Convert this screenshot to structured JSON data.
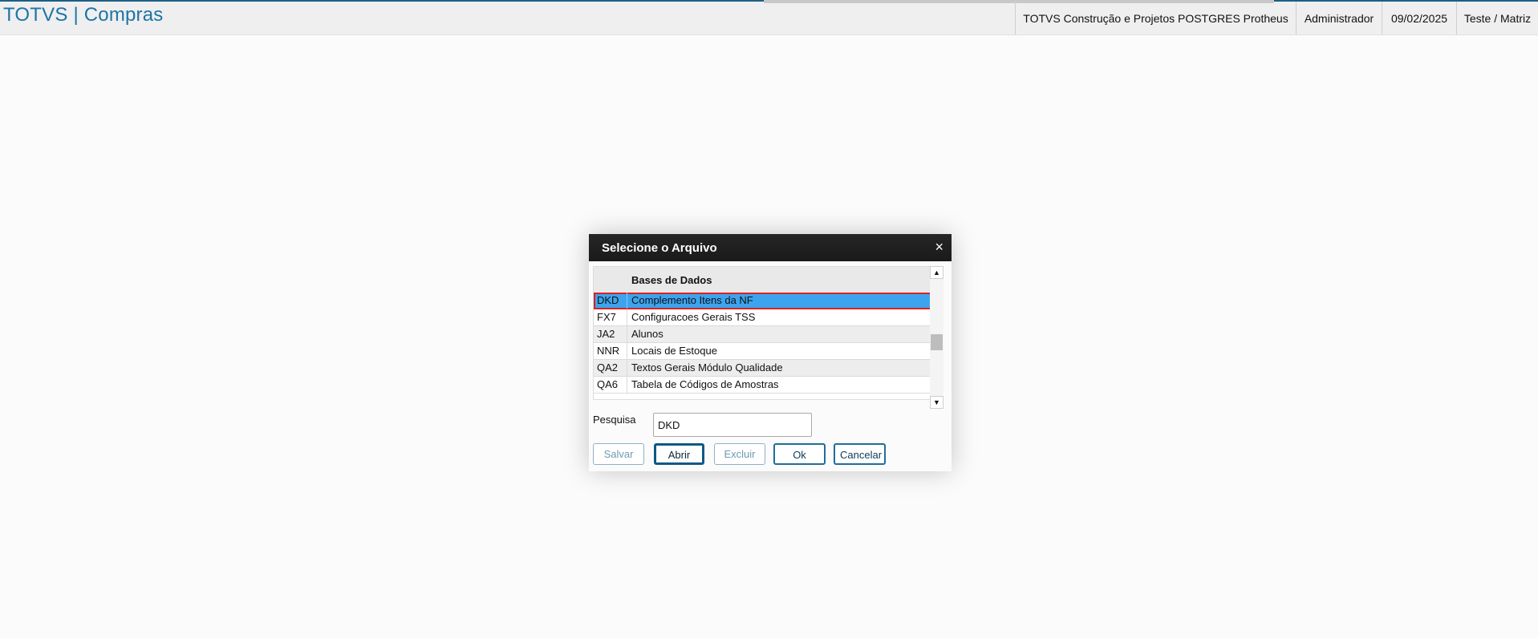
{
  "header": {
    "app_title": "TOTVS | Compras",
    "company": "TOTVS Construção e Projetos POSTGRES Protheus",
    "user": "Administrador",
    "date": "09/02/2025",
    "branch": "Teste / Matriz"
  },
  "dialog": {
    "title": "Selecione o Arquivo",
    "close_glyph": "×",
    "grid": {
      "column_header": "Bases de Dados",
      "rows": [
        {
          "code": "DKD",
          "name": "Complemento Itens da NF",
          "selected": true
        },
        {
          "code": "FX7",
          "name": "Configuracoes Gerais TSS",
          "selected": false
        },
        {
          "code": "JA2",
          "name": "Alunos",
          "selected": false
        },
        {
          "code": "NNR",
          "name": "Locais de Estoque",
          "selected": false
        },
        {
          "code": "QA2",
          "name": "Textos Gerais Módulo Qualidade",
          "selected": false
        },
        {
          "code": "QA6",
          "name": "Tabela de Códigos de Amostras",
          "selected": false
        }
      ]
    },
    "scroll_up_glyph": "▲",
    "scroll_down_glyph": "▼",
    "search": {
      "label": "Pesquisa",
      "value": "DKD"
    },
    "buttons": {
      "save": "Salvar",
      "open": "Abrir",
      "delete": "Excluir",
      "ok": "Ok",
      "cancel": "Cancelar"
    }
  },
  "colors": {
    "accent": "#1c74a8",
    "selection": "#3ca4ee",
    "highlight_border": "#e01f1f",
    "dialog_header": "#1f1f1f"
  }
}
